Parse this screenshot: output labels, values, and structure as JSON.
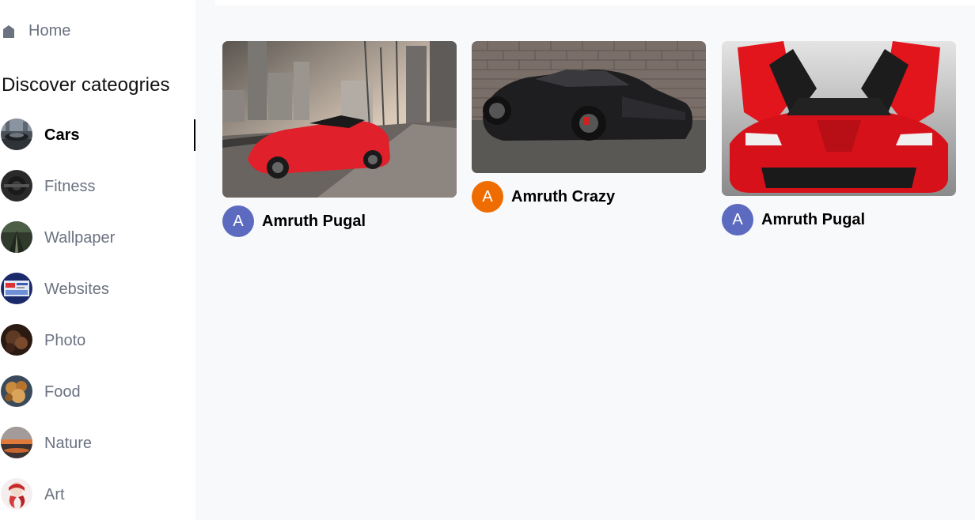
{
  "sidebar": {
    "home_label": "Home",
    "discover_title": "Discover cateogries",
    "categories": [
      {
        "label": "Cars",
        "active": true
      },
      {
        "label": "Fitness"
      },
      {
        "label": "Wallpaper"
      },
      {
        "label": "Websites"
      },
      {
        "label": "Photo"
      },
      {
        "label": "Food"
      },
      {
        "label": "Nature"
      },
      {
        "label": "Art"
      }
    ]
  },
  "posts": [
    {
      "author": "Amruth Pugal",
      "avatar_letter": "A",
      "avatar_color": "#5c6bc0",
      "image": "red sports car convertible in city"
    },
    {
      "author": "Amruth Crazy",
      "avatar_letter": "A",
      "avatar_color": "#ef6c00",
      "image": "black sports car in front of brick wall"
    },
    {
      "author": "Amruth Pugal",
      "avatar_letter": "A",
      "avatar_color": "#5c6bc0",
      "image": "red hypercar with butterfly doors open"
    }
  ],
  "colors": {
    "sidebar_bg": "#ffffff",
    "main_bg": "#f8f9fb",
    "muted_text": "#6b7280",
    "active_indicator": "#000000"
  },
  "icons": {
    "home": "home-icon"
  }
}
